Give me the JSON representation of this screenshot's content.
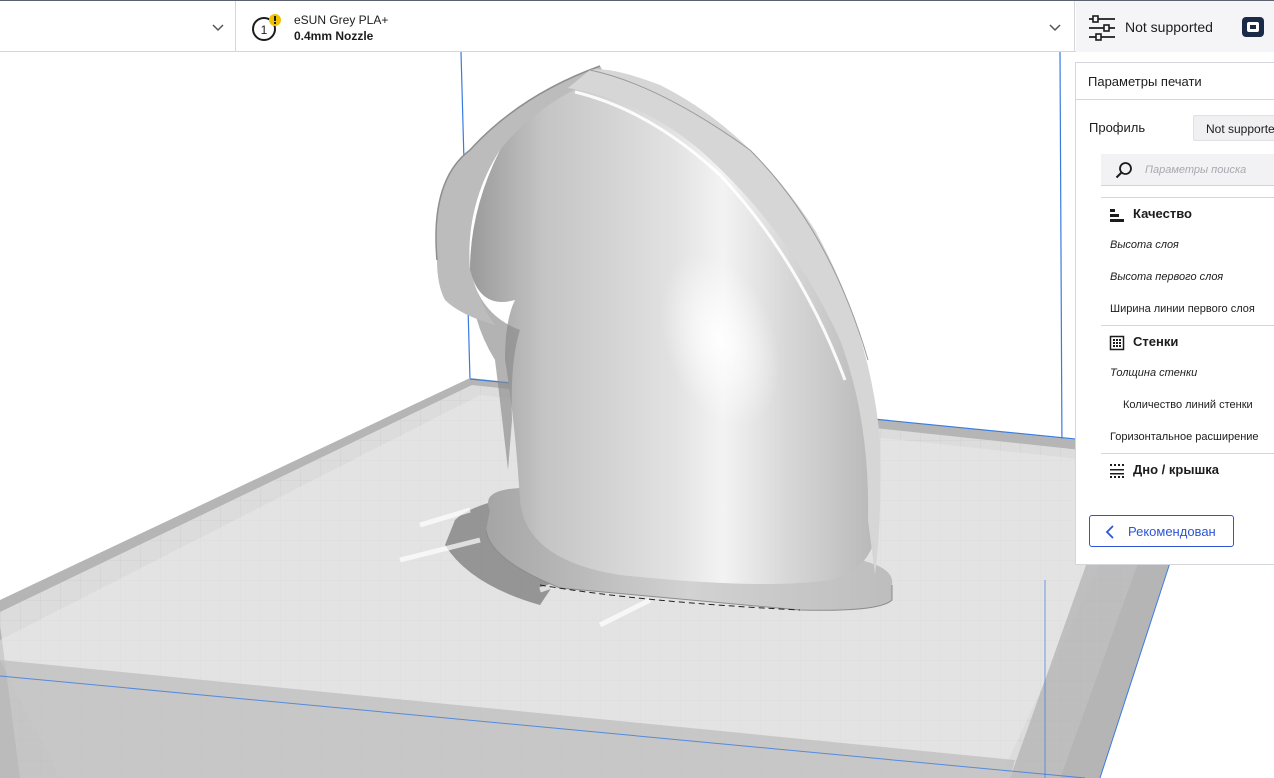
{
  "toolbar": {
    "extruder_number": "1",
    "material_name": "eSUN Grey PLA+",
    "nozzle_name": "0.4mm Nozzle",
    "settings_status": "Not supported"
  },
  "print_settings": {
    "title": "Параметры печати",
    "profile_label": "Профиль",
    "profile_value": "Not supported",
    "search_placeholder": "Параметры поиска",
    "categories": [
      {
        "label": "Качество",
        "icon": "quality-icon",
        "settings": [
          {
            "label": "Высота слоя"
          },
          {
            "label": "Высота первого слоя"
          },
          {
            "label": "Ширина линии первого слоя"
          }
        ]
      },
      {
        "label": "Стенки",
        "icon": "walls-icon",
        "settings": [
          {
            "label": "Толщина стенки"
          },
          {
            "label": "Количество линий стенки"
          },
          {
            "label": "Горизонтальное расширение"
          }
        ]
      },
      {
        "label": "Дно / крышка",
        "icon": "top-bottom-icon",
        "settings": []
      }
    ],
    "recommended_button": "Рекомендован"
  },
  "colors": {
    "accent": "#2d55d8",
    "warning": "#f2c200",
    "build_plate": "#dcdcdc",
    "model": "#c8c8c8"
  }
}
